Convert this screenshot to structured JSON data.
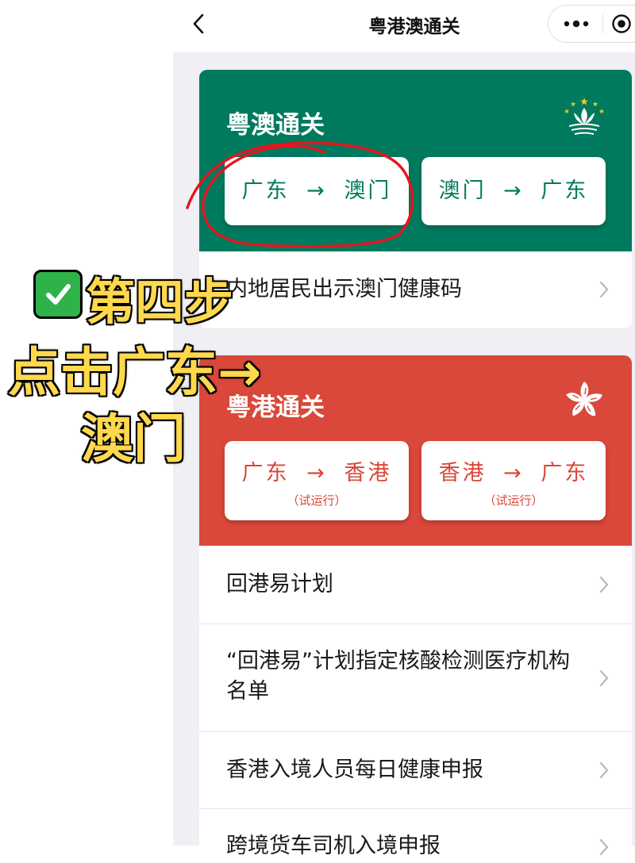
{
  "nav": {
    "title": "粤港澳通关"
  },
  "macau": {
    "title": "粤澳通关",
    "buttons": [
      {
        "label": "广东 → 澳门"
      },
      {
        "label": "澳门 → 广东"
      }
    ],
    "rows": [
      {
        "label": "内地居民出示澳门健康码"
      }
    ]
  },
  "hk": {
    "title": "粤港通关",
    "buttons": [
      {
        "label": "广东 → 香港",
        "note": "（试运行）"
      },
      {
        "label": "香港 → 广东",
        "note": "（试运行）"
      }
    ],
    "rows": [
      {
        "label": "回港易计划"
      },
      {
        "label": "“回港易”计划指定核酸检测医疗机构名单"
      },
      {
        "label": "香港入境人员每日健康申报"
      },
      {
        "label": "跨境货车司机入境申报"
      }
    ]
  },
  "annotation": {
    "line1": "第四步",
    "line2": "点击广东→",
    "line3": "澳门"
  },
  "colors": {
    "macau_green": "#007a5e",
    "hk_red": "#d9483a",
    "annotation_yellow": "#ffd84d",
    "annotation_circle": "#e8141e"
  }
}
